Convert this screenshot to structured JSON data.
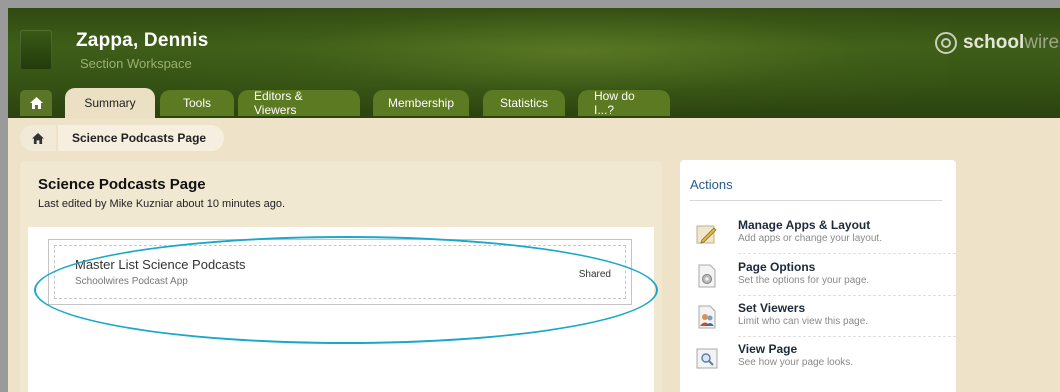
{
  "header": {
    "user_name": "Zappa, Dennis",
    "workspace_label": "Section Workspace",
    "brand_bold": "school",
    "brand_light": "wires"
  },
  "tabs": [
    {
      "label": "Summary",
      "active": true
    },
    {
      "label": "Tools"
    },
    {
      "label": "Editors & Viewers"
    },
    {
      "label": "Membership"
    },
    {
      "label": "Statistics"
    },
    {
      "label": "How do I...?"
    }
  ],
  "breadcrumb": {
    "page": "Science Podcasts Page"
  },
  "main": {
    "title": "Science Podcasts Page",
    "edited_note": "Last edited by Mike Kuzniar about 10 minutes ago.",
    "app": {
      "title": "Master List Science Podcasts",
      "subtitle": "Schoolwires Podcast App",
      "status": "Shared"
    }
  },
  "actions": {
    "title": "Actions",
    "items": [
      {
        "label": "Manage Apps & Layout",
        "desc": "Add apps or change your layout.",
        "icon": "pencil-icon"
      },
      {
        "label": "Page Options",
        "desc": "Set the options for your page.",
        "icon": "gear-page-icon"
      },
      {
        "label": "Set Viewers",
        "desc": "Limit who can view this page.",
        "icon": "people-icon"
      },
      {
        "label": "View Page",
        "desc": "See how your page looks.",
        "icon": "magnifier-icon"
      }
    ]
  },
  "colors": {
    "header_green": "#3f5e18",
    "tab_green": "#5c7a22",
    "page_bg": "#eee2c8",
    "highlight": "#1aa7c9",
    "actions_title": "#2a5a86"
  }
}
